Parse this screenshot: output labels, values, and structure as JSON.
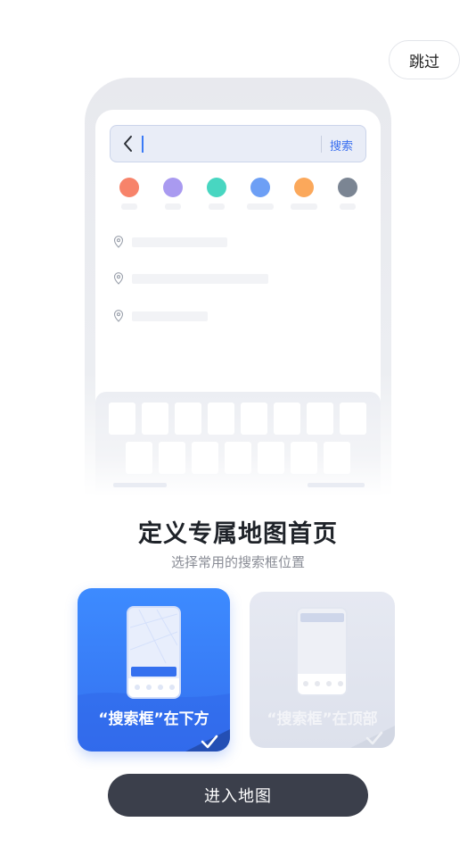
{
  "header": {
    "skip_label": "跳过"
  },
  "preview": {
    "search_button_label": "搜索",
    "icons": [
      "back-chevron-icon",
      "location-pin-icon",
      "keyboard-icon",
      "checkmark-icon"
    ],
    "category_colors": [
      "#f7836a",
      "#a99af0",
      "#48d6c1",
      "#6d9ff5",
      "#fba85b",
      "#7b8593"
    ]
  },
  "main": {
    "title": "定义专属地图首页",
    "subtitle": "选择常用的搜索框位置"
  },
  "options": [
    {
      "label": "“搜索框”在下方",
      "selected": true
    },
    {
      "label": "“搜索框”在顶部",
      "selected": false
    }
  ],
  "footer": {
    "enter_label": "进入地图"
  },
  "colors": {
    "accent": "#3470ef",
    "button_dark": "#3b3f4b"
  }
}
